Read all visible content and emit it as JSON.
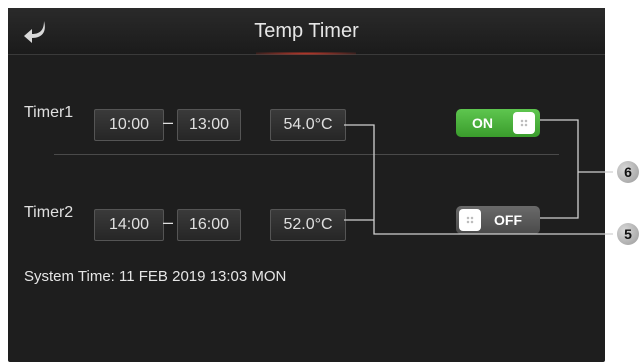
{
  "header": {
    "back_icon": "back-arrow-icon",
    "title": "Temp Timer",
    "accent_color": "#c0392b"
  },
  "timers": [
    {
      "label": "Timer1",
      "start": "10:00",
      "end": "13:00",
      "temperature": "54.0°C",
      "switch": {
        "label": "ON",
        "state": "on",
        "color": "#4caf3f"
      }
    },
    {
      "label": "Timer2",
      "start": "14:00",
      "end": "16:00",
      "temperature": "52.0°C",
      "switch": {
        "label": "OFF",
        "state": "off",
        "color": "#5a5a5a"
      }
    }
  ],
  "separator": "–",
  "system_time": "System Time: 11 FEB 2019 13:03 MON",
  "callouts": {
    "switches": "6",
    "temperatures": "5"
  }
}
